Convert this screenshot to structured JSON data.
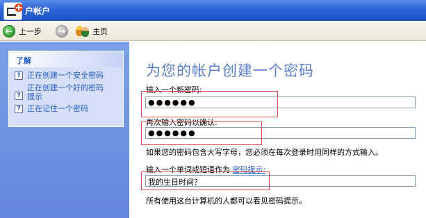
{
  "window": {
    "title": "户帐户"
  },
  "nav": {
    "back_label": "上一步",
    "home_label": "主页"
  },
  "sidebar": {
    "header": "了解",
    "items": [
      {
        "label": "正在创建一个安全密码"
      },
      {
        "label": "正在创建一个好的密码提示"
      },
      {
        "label": "正在记住一个密码"
      }
    ]
  },
  "main": {
    "title": "为您的帐户创建一个密码",
    "new_password_label": "输入一个新密码:",
    "new_password_value": "●●●●●●",
    "confirm_label": "再次输入密码以确认:",
    "confirm_value": "●●●●●●",
    "caps_note": "如果您的密码包含大写字母，您必须在每次登录时用同样的方式输入。",
    "hint_label_prefix": "输入一个单词或短语作为",
    "hint_link": "密码提示:",
    "hint_value": "我的生日时间？",
    "hint_note": "所有使用这台计算机的人都可以看见密码提示。"
  },
  "colors": {
    "accent": "#215dc6",
    "title_blue": "#5a7fc7",
    "highlight_red": "#d94a4a"
  }
}
